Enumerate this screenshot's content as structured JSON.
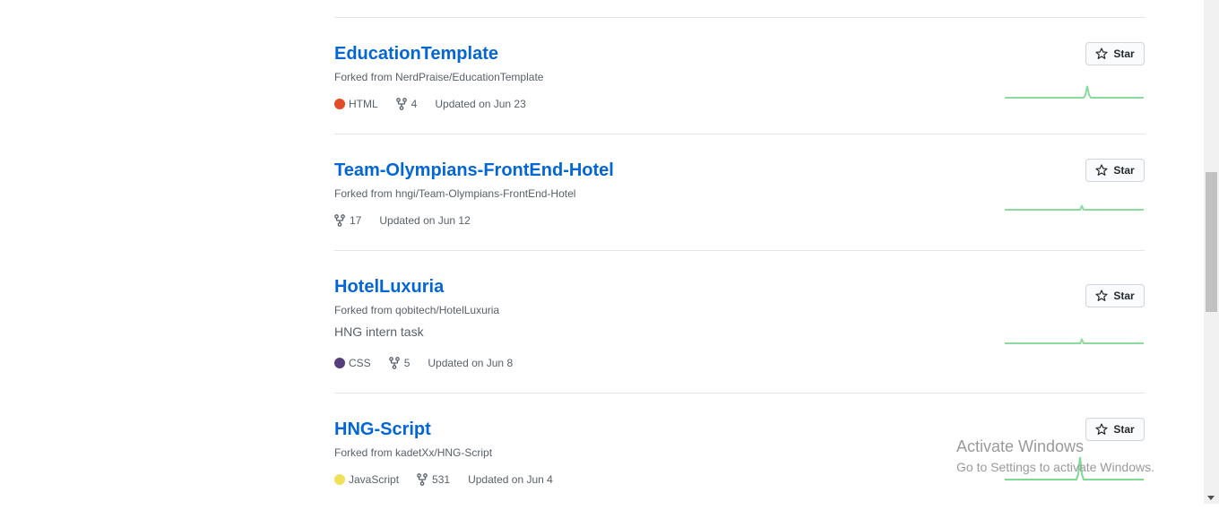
{
  "repos": [
    {
      "name": "EducationTemplate",
      "forked_prefix": "Forked from",
      "forked_from": "NerdPraise/EducationTemplate",
      "language": "HTML",
      "language_color": "#e34c26",
      "forks": "4",
      "updated": "Updated on Jun 23",
      "star_label": "Star"
    },
    {
      "name": "Team-Olympians-FrontEnd-Hotel",
      "forked_prefix": "Forked from",
      "forked_from": "hngi/Team-Olympians-FrontEnd-Hotel",
      "forks": "17",
      "updated": "Updated on Jun 12",
      "star_label": "Star"
    },
    {
      "name": "HotelLuxuria",
      "forked_prefix": "Forked from",
      "forked_from": "qobitech/HotelLuxuria",
      "description": "HNG intern task",
      "language": "CSS",
      "language_color": "#563d7c",
      "forks": "5",
      "updated": "Updated on Jun 8",
      "star_label": "Star"
    },
    {
      "name": "HNG-Script",
      "forked_prefix": "Forked from",
      "forked_from": "kadetXx/HNG-Script",
      "language": "JavaScript",
      "language_color": "#f1e05a",
      "forks": "531",
      "updated": "Updated on Jun 4",
      "star_label": "Star"
    }
  ],
  "icons": {
    "star": "star-icon",
    "fork": "repo-forked-icon"
  },
  "colors": {
    "link": "#0366d6",
    "muted": "#586069",
    "sparkline": "#2cbe4e"
  },
  "watermark": {
    "title": "Activate Windows",
    "subtitle": "Go to Settings to activate Windows."
  }
}
